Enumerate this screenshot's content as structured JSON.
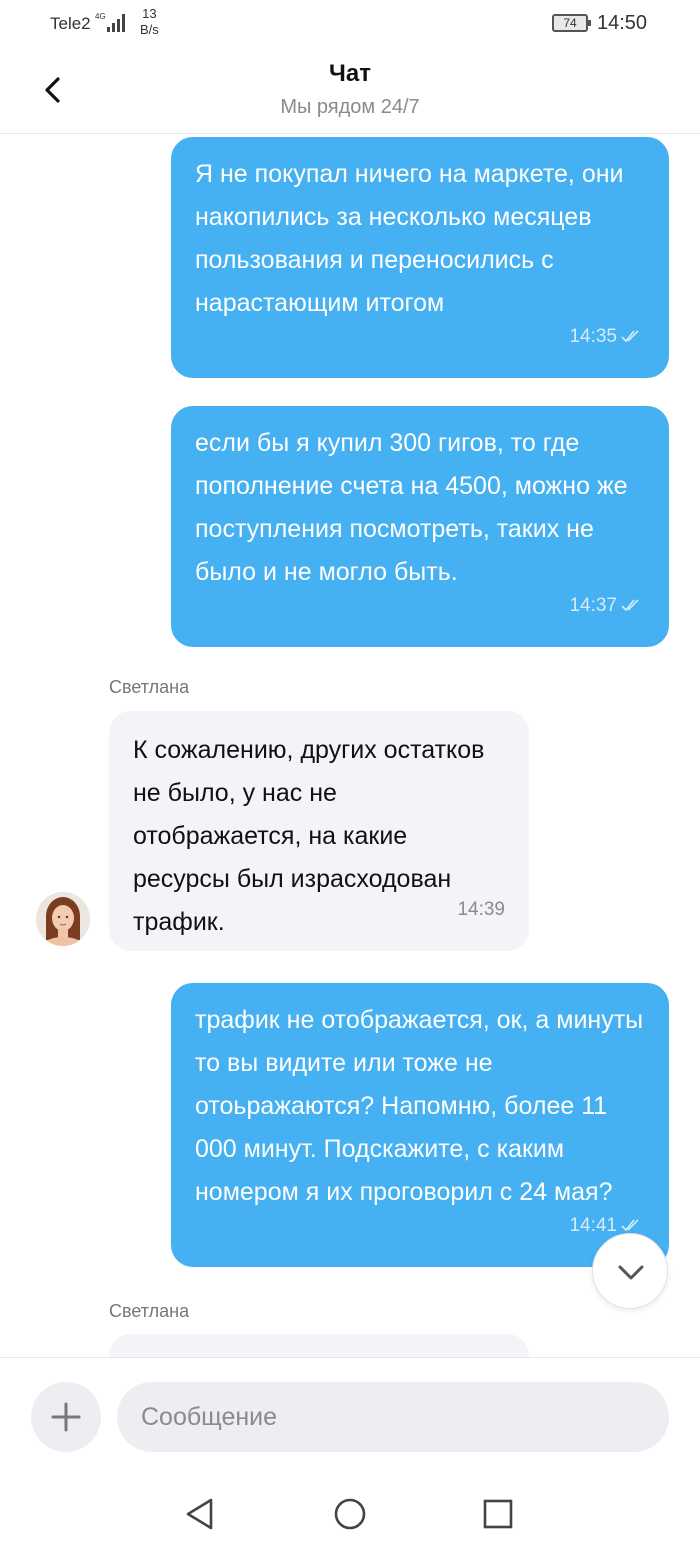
{
  "status_bar": {
    "carrier": "Tele2",
    "network": "4G",
    "data_rate_value": "13",
    "data_rate_unit": "B/s",
    "battery": "74",
    "time": "14:50"
  },
  "header": {
    "title": "Чат",
    "subtitle": "Мы рядом 24/7"
  },
  "messages": [
    {
      "direction": "out",
      "text": "Я не покупал ничего на маркете, они накопились за несколько месяцев пользования и переносились  с нарастающим итогом",
      "time": "14:35",
      "status": "read"
    },
    {
      "direction": "out",
      "text": "если бы я купил 300 гигов, то где пополнение счета на 4500, можно же поступления посмотреть, таких не было и не могло быть.",
      "time": "14:37",
      "status": "read"
    },
    {
      "direction": "in",
      "sender": "Светлана",
      "text": "К сожалению, других остатков не было, у нас не отображается, на какие ресурсы был израсходован трафик.",
      "time": "14:39"
    },
    {
      "direction": "out",
      "text": "трафик не отображается, ок, а минуты то вы видите или тоже не отоьражаются? Напомню, более 11 000 минут. Подскажите, с каким номером я их проговорил с 24 мая?",
      "time": "14:41",
      "status": "read"
    },
    {
      "direction": "in",
      "sender": "Светлана",
      "text": "",
      "time": ""
    }
  ],
  "input": {
    "placeholder": "Сообщение"
  },
  "icons": {
    "back": "back-arrow-icon",
    "add": "plus-icon",
    "scroll_down": "chevron-down-icon",
    "nav_back": "triangle-back-icon",
    "nav_home": "circle-home-icon",
    "nav_recents": "square-recents-icon"
  },
  "colors": {
    "outgoing_bubble": "#45b0f2",
    "incoming_bubble": "#f3f4f8",
    "input_background": "#eceef2"
  }
}
